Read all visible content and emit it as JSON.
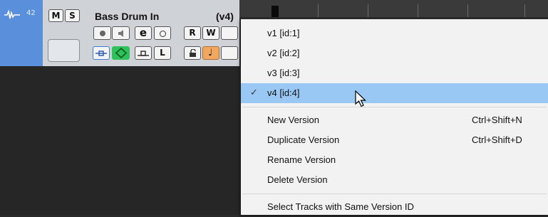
{
  "track": {
    "number": "42",
    "mute_label": "M",
    "solo_label": "S",
    "name": "Bass Drum In",
    "version": "(v4)",
    "edit_label": "e",
    "read_label": "R",
    "write_label": "W",
    "lock_label": "L"
  },
  "menu": {
    "versions": [
      {
        "label": "v1 [id:1]"
      },
      {
        "label": "v2 [id:2]"
      },
      {
        "label": "v3 [id:3]"
      },
      {
        "label": "v4 [id:4]",
        "checked": true
      }
    ],
    "check_glyph": "✓",
    "actions": [
      {
        "label": "New Version",
        "shortcut": "Ctrl+Shift+N"
      },
      {
        "label": "Duplicate Version",
        "shortcut": "Ctrl+Shift+D"
      },
      {
        "label": "Rename Version",
        "shortcut": ""
      },
      {
        "label": "Delete Version",
        "shortcut": ""
      }
    ],
    "select_same_id": "Select Tracks with Same Version ID"
  },
  "colors": {
    "track_side": "#5a8fdc",
    "selected_item": "#99c8f5",
    "monitor_green": "#2fc15a",
    "orange_button": "#f0a860",
    "blue_button_border": "#3d7fd6"
  }
}
